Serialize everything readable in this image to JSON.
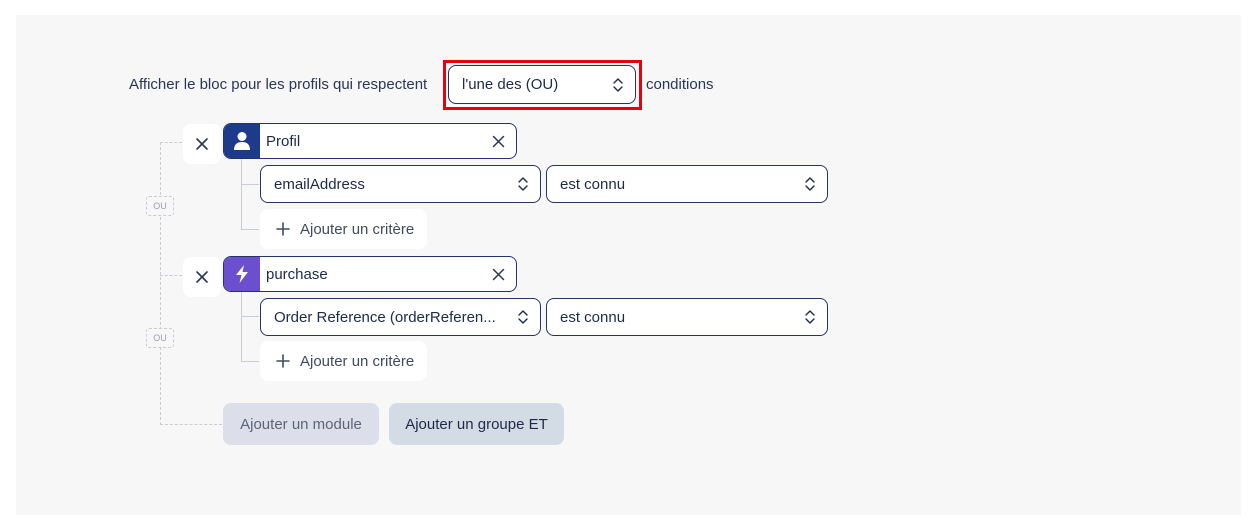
{
  "intro": {
    "prefix": "Afficher le bloc pour les profils qui respectent",
    "match_select": "l'une des (OU)",
    "suffix": "conditions"
  },
  "connector_label": "OU",
  "groups": [
    {
      "module": {
        "name": "Profil",
        "icon": "user-icon",
        "icon_bg": "#1e3a8a"
      },
      "criteria": {
        "field": "emailAddress",
        "operator": "est connu"
      },
      "add_criterion": "Ajouter un critère"
    },
    {
      "module": {
        "name": "purchase",
        "icon": "lightning-icon",
        "icon_bg": "#6b4fcf"
      },
      "criteria": {
        "field": "Order Reference (orderReferen...",
        "operator": "est connu"
      },
      "add_criterion": "Ajouter un critère"
    }
  ],
  "actions": {
    "add_module": "Ajouter un module",
    "add_and_group": "Ajouter un groupe ET"
  },
  "colors": {
    "border": "#23346b",
    "highlight": "#e2030d",
    "panel_bg": "#f7f7f7",
    "add_module_bg": "#dcdfe9",
    "add_group_bg": "#d3dbe4"
  }
}
